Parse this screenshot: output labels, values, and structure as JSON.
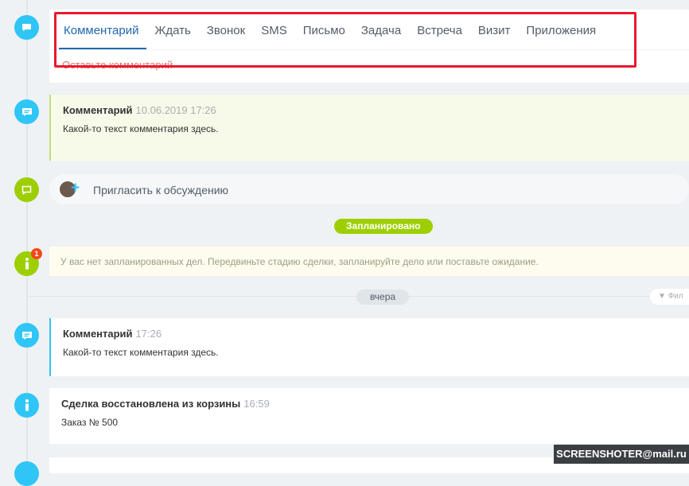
{
  "composer": {
    "tabs": [
      {
        "label": "Комментарий",
        "active": true
      },
      {
        "label": "Ждать"
      },
      {
        "label": "Звонок"
      },
      {
        "label": "SMS"
      },
      {
        "label": "Письмо"
      },
      {
        "label": "Задача"
      },
      {
        "label": "Встреча"
      },
      {
        "label": "Визит"
      },
      {
        "label": "Приложения"
      }
    ],
    "placeholder": "Оставьте комментарий"
  },
  "timeline": {
    "comment_1": {
      "title": "Комментарий",
      "time": "10.06.2019 17:26",
      "text": "Какой-то текст комментария здесь."
    },
    "invite": {
      "label": "Пригласить к обсуждению"
    },
    "planned_badge": "Запланировано",
    "notice": {
      "count": "1",
      "text": "У вас нет запланированных дел. Передвиньте стадию сделки, запланируйте дело или поставьте ожидание."
    },
    "day_badge": "вчера",
    "filter_label": "Фил",
    "comment_2": {
      "title": "Комментарий",
      "time": "17:26",
      "text": "Какой-то текст комментария здесь."
    },
    "deal": {
      "title": "Сделка восстановлена из корзины",
      "time": "16:59",
      "text": "Заказ № 500"
    }
  },
  "watermark": "SCREENSHOTER@mail.ru",
  "colors": {
    "accent_blue": "#2fc6f6",
    "accent_green": "#9dcf00",
    "tab_active": "#2067b0",
    "highlight": "#e8192c"
  }
}
